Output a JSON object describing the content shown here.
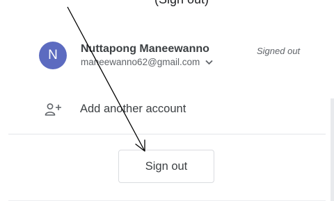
{
  "header": {
    "partial_text": "(Sign out)"
  },
  "account": {
    "avatar_initial": "N",
    "name": "Nuttapong Maneewanno",
    "email": "maneewanno62@gmail.com",
    "status": "Signed out",
    "avatar_color": "#5c6bc0",
    "email_menu_icon": "chevron-down-icon"
  },
  "add_account": {
    "icon": "person-add-icon",
    "label": "Add another account"
  },
  "sign_out": {
    "label": "Sign out"
  },
  "annotation": {
    "type": "arrow",
    "color": "#000000",
    "points_to": "sign-out-button"
  }
}
